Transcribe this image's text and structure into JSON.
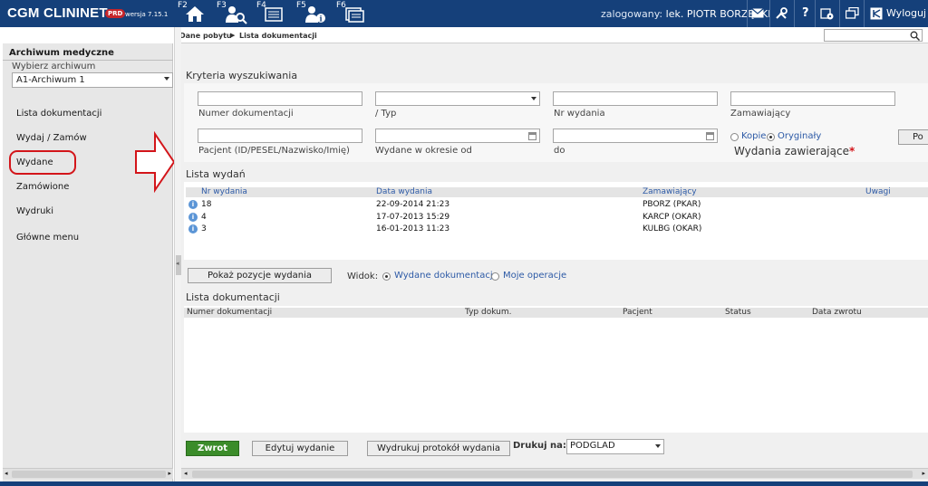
{
  "app": {
    "brand": "CGM CLININET",
    "edition_badge": "PRD",
    "version": "wersja 7.15.1",
    "fkeys": [
      {
        "key": "F2",
        "icon": "home-icon"
      },
      {
        "key": "F3",
        "icon": "patient-search-icon"
      },
      {
        "key": "F4",
        "icon": "list-icon"
      },
      {
        "key": "F5",
        "icon": "patient-info-icon"
      },
      {
        "key": "F6",
        "icon": "documents-icon"
      }
    ],
    "login_label": "zalogowany:",
    "login_user": "lek. PIOTR BORZĘCKI",
    "help_label": "?",
    "logout_label": "Wyloguj",
    "accent_color": "#15407a"
  },
  "breadcrumb": {
    "items": [
      "Dane pobytu",
      "Lista dokumentacji"
    ]
  },
  "search": {
    "value": "",
    "icon": "search-icon"
  },
  "sidebar": {
    "title": "Archiwum medyczne",
    "archive_label": "Wybierz archiwum",
    "archive_value": "A1-Archiwum 1",
    "items": [
      {
        "label": "Lista dokumentacji"
      },
      {
        "label": "Wydaj / Zamów"
      },
      {
        "label": "Wydane"
      },
      {
        "label": "Zamówione"
      },
      {
        "label": "Wydruki"
      },
      {
        "label": "Główne menu"
      }
    ],
    "selected": "Wydane"
  },
  "criteria": {
    "title": "Kryteria wyszukiwania",
    "fields": {
      "doc_number_label": "Numer dokumentacji",
      "type_label": "/ Typ",
      "issue_number_label": "Nr wydania",
      "orderer_label": "Zamawiający",
      "patient_label": "Pacjent (ID/PESEL/Nazwisko/Imię)",
      "issued_from_label": "Wydane w okresie od",
      "to_label": "do"
    },
    "copy_radio": "Kopie",
    "original_radio": "Oryginały",
    "radio_selected": "Oryginały",
    "containing_label": "Wydania zawierające",
    "required_mark": "*",
    "search_button_partial": "Po"
  },
  "issues": {
    "title": "Lista wydań",
    "columns": [
      "Nr wydania",
      "Data wydania",
      "Zamawiający",
      "Uwagi"
    ],
    "rows": [
      {
        "nr": "18",
        "date": "22-09-2014 21:23",
        "orderer": "PBORZ (PKAR)",
        "notes": ""
      },
      {
        "nr": "4",
        "date": "17-07-2013 15:29",
        "orderer": "KARCP (OKAR)",
        "notes": ""
      },
      {
        "nr": "3",
        "date": "16-01-2013 11:23",
        "orderer": "KULBG (OKAR)",
        "notes": ""
      }
    ],
    "show_positions_button": "Pokaż pozycje wydania",
    "view_label": "Widok:",
    "view_options": [
      "Wydane dokumentacje",
      "Moje operacje"
    ],
    "view_selected": "Wydane dokumentacje"
  },
  "documents": {
    "title": "Lista dokumentacji",
    "columns": [
      "Numer dokumentacji",
      "Typ dokum.",
      "Pacjent",
      "Status",
      "Data zwrotu"
    ],
    "rows": []
  },
  "actions": {
    "return_button": "Zwrot",
    "edit_button": "Edytuj wydanie",
    "print_protocol_button": "Wydrukuj protokół wydania",
    "print_to_label": "Drukuj na:",
    "print_to_value": "PODGLAD"
  }
}
